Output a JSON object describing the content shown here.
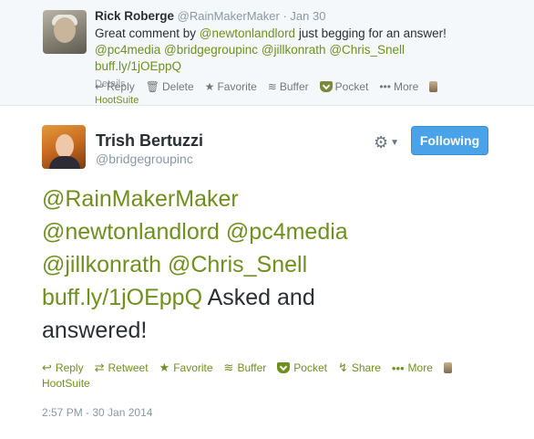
{
  "parent_tweet": {
    "name": "Rick Roberge",
    "handle": "@RainMakerMaker",
    "separator": "·",
    "time": "Jan 30",
    "text_prefix": "Great comment by ",
    "mention1": "@newtonlandlord",
    "text_mid": " just begging for an answer!",
    "mention2": "@pc4media",
    "mention3": "@bridgegroupinc",
    "mention4": "@jillkonrath",
    "mention5": "@Chris_Snell",
    "link": "buff.ly/1jOEppQ",
    "ghost_details": "Details",
    "ghost_via": "HootSuite",
    "actions": {
      "reply": "Reply",
      "delete": "Delete",
      "favorite": "Favorite",
      "buffer": "Buffer",
      "pocket": "Pocket",
      "more": "More"
    }
  },
  "main_tweet": {
    "name": "Trish Bertuzzi",
    "handle": "@bridgegroupinc",
    "follow_label": "Following",
    "mention1": "@RainMakerMaker",
    "mention2": "@newtonlandlord",
    "mention3": "@pc4media",
    "mention4": "@jillkonrath",
    "mention5": "@Chris_Snell",
    "link": "buff.ly/1jOEppQ",
    "text_tail": " Asked and answered!",
    "actions": {
      "reply": "Reply",
      "retweet": "Retweet",
      "favorite": "Favorite",
      "buffer": "Buffer",
      "pocket": "Pocket",
      "share": "Share",
      "more": "More"
    },
    "via": "HootSuite",
    "timestamp": "2:57 PM - 30 Jan 2014"
  },
  "colors": {
    "link": "#6f8f1f",
    "follow_button": "#4aa3e8",
    "parent_bg": "#f5f8fa"
  },
  "icons": {
    "gear": "gear-icon",
    "reply": "reply-arrow-icon",
    "retweet": "retweet-icon",
    "favorite": "star-icon",
    "buffer": "stack-icon",
    "pocket": "pocket-icon",
    "share": "share-icon",
    "more": "ellipsis-icon",
    "extension": "extension-icon"
  }
}
